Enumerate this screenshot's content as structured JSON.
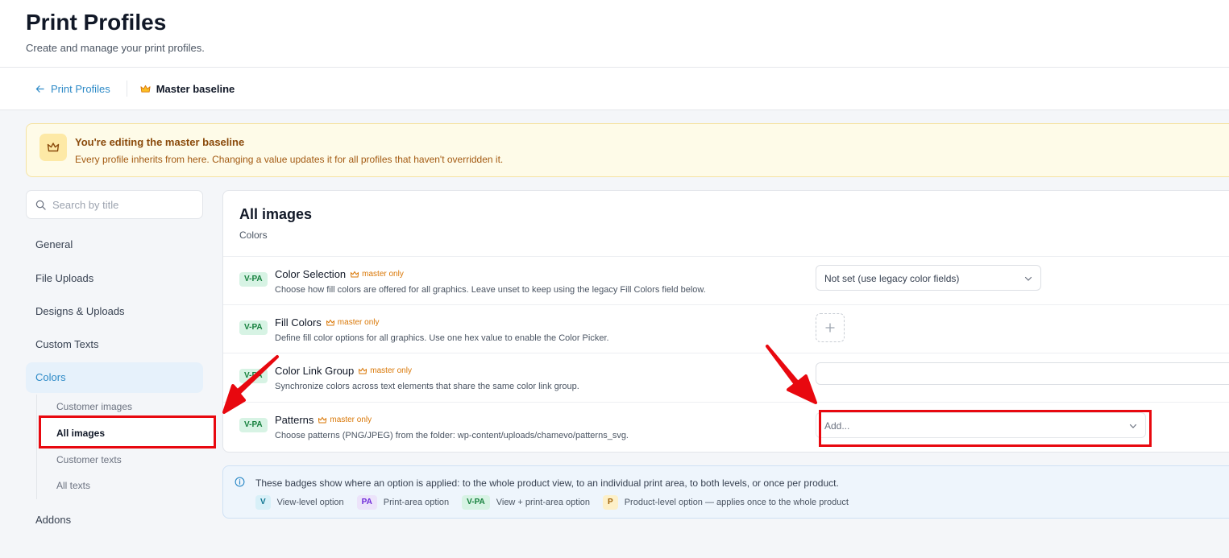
{
  "header": {
    "title": "Print Profiles",
    "subtitle": "Create and manage your print profiles."
  },
  "breadcrumb": {
    "back_label": "Print Profiles",
    "current_label": "Master baseline"
  },
  "notice": {
    "title": "You're editing the master baseline",
    "text": "Every profile inherits from here. Changing a value updates it for all profiles that haven't overridden it."
  },
  "search": {
    "placeholder": "Search by title"
  },
  "sidebar": {
    "items": [
      {
        "label": "General"
      },
      {
        "label": "File Uploads"
      },
      {
        "label": "Designs & Uploads"
      },
      {
        "label": "Custom Texts"
      },
      {
        "label": "Colors"
      },
      {
        "label": "Addons"
      }
    ],
    "subitems": [
      {
        "label": "Customer images"
      },
      {
        "label": "All images"
      },
      {
        "label": "Customer texts"
      },
      {
        "label": "All texts"
      }
    ]
  },
  "panel": {
    "title": "All images",
    "subtitle": "Colors",
    "rows": [
      {
        "badge": "V-PA",
        "title": "Color Selection",
        "tag": "master only",
        "desc": "Choose how fill colors are offered for all graphics. Leave unset to keep using the legacy Fill Colors field below.",
        "control_value": "Not set (use legacy color fields)"
      },
      {
        "badge": "V-PA",
        "title": "Fill Colors",
        "tag": "master only",
        "desc": "Define fill color options for all graphics. Use one hex value to enable the Color Picker."
      },
      {
        "badge": "V-PA",
        "title": "Color Link Group",
        "tag": "master only",
        "desc": "Synchronize colors across text elements that share the same color link group."
      },
      {
        "badge": "V-PA",
        "title": "Patterns",
        "tag": "master only",
        "desc": "Choose patterns (PNG/JPEG) from the folder: wp-content/uploads/chamevo/patterns_svg.",
        "control_value": "Add..."
      }
    ]
  },
  "legend": {
    "text": "These badges show where an option is applied: to the whole product view, to an individual print area, to both levels, or once per product.",
    "items": [
      {
        "badge": "V",
        "label": "View-level option"
      },
      {
        "badge": "PA",
        "label": "Print-area option"
      },
      {
        "badge": "V-PA",
        "label": "View + print-area option"
      },
      {
        "badge": "P",
        "label": "Product-level option — applies once to the whole product"
      }
    ]
  },
  "colors": {
    "accent": "#2d8ac7",
    "annotation": "#e8080f",
    "master_tag": "#d97706"
  },
  "icons": [
    "arrow-left-icon",
    "crown-icon",
    "search-icon",
    "chevron-down-icon",
    "plus-icon",
    "info-icon"
  ]
}
